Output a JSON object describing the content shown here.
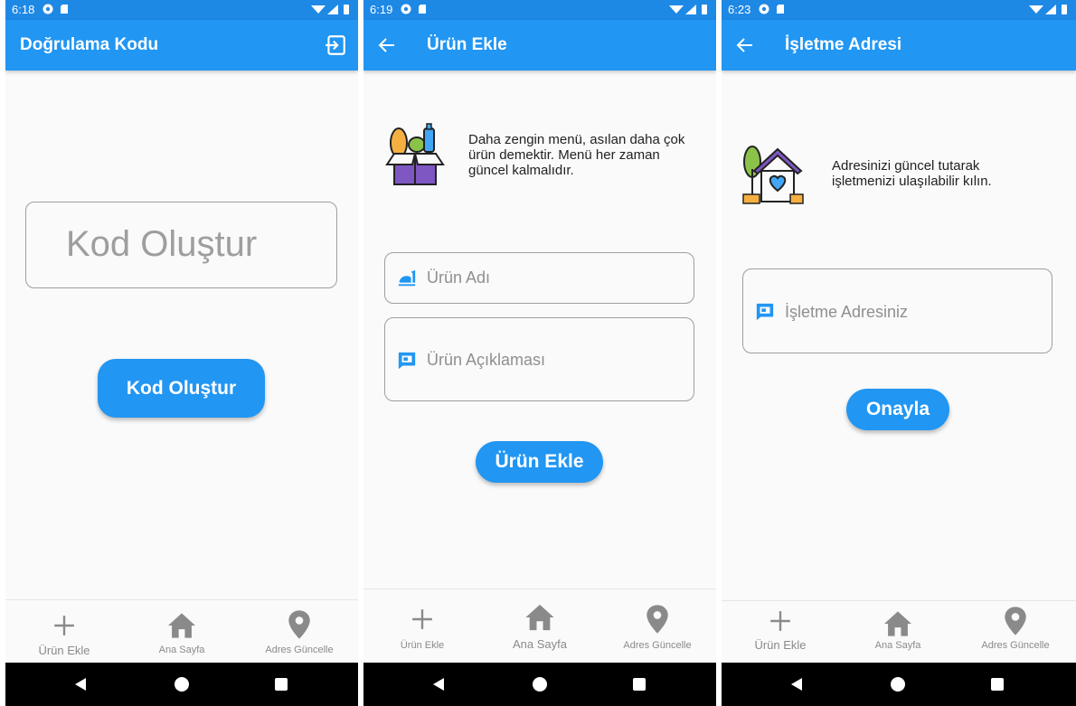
{
  "status": {
    "screen1_time": "6:18",
    "screen2_time": "6:19",
    "screen3_time": "6:23"
  },
  "screen1": {
    "title": "Doğrulama Kodu",
    "code_field": "Kod Oluştur",
    "button": "Kod Oluştur",
    "exit_icon": "exit-icon"
  },
  "screen2": {
    "title": "Ürün Ekle",
    "info": "Daha zengin menü, asılan daha çok ürün demektir. Menü her zaman güncel kalmalıdır.",
    "name_placeholder": "Ürün Adı",
    "desc_placeholder": "Ürün Açıklaması",
    "button": "Ürün Ekle"
  },
  "screen3": {
    "title": "İşletme Adresi",
    "info": "Adresinizi güncel tutarak işletmenizi ulaşılabilir kılın.",
    "address_placeholder": "İşletme Adresiniz",
    "button": "Onayla"
  },
  "bottom_nav": {
    "add": "Ürün Ekle",
    "home": "Ana Sayfa",
    "address": "Adres Güncelle"
  },
  "icons": {
    "add": "plus-icon",
    "home": "home-icon",
    "address": "location-pin-icon",
    "back": "arrow-left-icon",
    "field": "comment-icon",
    "food": "food-icon"
  },
  "colors": {
    "appbar": "#2196f3",
    "statusbar": "#1e88e5",
    "accent": "#2196f3",
    "nav_inactive": "#8a8a8a"
  }
}
